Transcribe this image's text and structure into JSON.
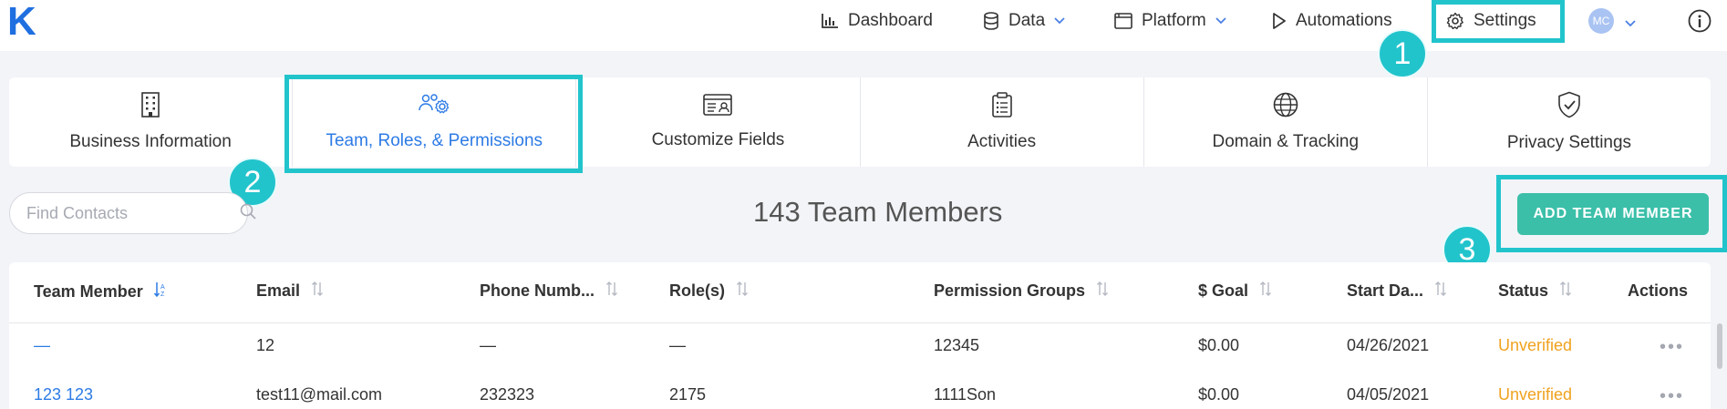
{
  "app": {
    "logo_letter": "K",
    "accent_color": "#1f6fe0",
    "highlight_color": "#22c4cc"
  },
  "nav": {
    "dashboard": "Dashboard",
    "data": "Data",
    "platform": "Platform",
    "automations": "Automations",
    "settings": "Settings",
    "avatar_initials": "MC"
  },
  "callouts": {
    "one": "1",
    "two": "2",
    "three": "3"
  },
  "tabs": [
    {
      "label": "Business Information",
      "icon": "building-icon"
    },
    {
      "label": "Team, Roles, & Permissions",
      "icon": "team-gear-icon",
      "active": true
    },
    {
      "label": "Customize Fields",
      "icon": "id-card-icon"
    },
    {
      "label": "Activities",
      "icon": "clipboard-icon"
    },
    {
      "label": "Domain & Tracking",
      "icon": "globe-icon"
    },
    {
      "label": "Privacy Settings",
      "icon": "shield-check-icon"
    }
  ],
  "toolbar": {
    "search_placeholder": "Find Contacts",
    "member_count": "143 Team Members",
    "add_button": "ADD TEAM MEMBER"
  },
  "table": {
    "columns": [
      "Team Member",
      "Email",
      "Phone Numb...",
      "Role(s)",
      "Permission Groups",
      "$ Goal",
      "Start Da...",
      "Status",
      "Actions"
    ],
    "rows": [
      {
        "member": "—",
        "email": "12",
        "phone": "—",
        "roles": "—",
        "groups": "12345",
        "goal": "$0.00",
        "start": "04/26/2021",
        "status": "Unverified"
      },
      {
        "member": "123 123",
        "email": "test11@mail.com",
        "phone": "232323",
        "roles": "2175",
        "groups": "1111Son",
        "goal": "$0.00",
        "start": "04/05/2021",
        "status": "Unverified"
      }
    ]
  }
}
